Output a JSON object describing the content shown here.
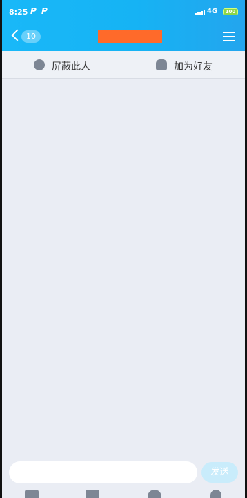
{
  "status_bar": {
    "time": "8:25",
    "app_icon_1": "P",
    "app_icon_2": "P",
    "network": "4G",
    "battery": "100"
  },
  "header": {
    "back_count": "10",
    "menu_icon": "hamburger-menu-icon",
    "title_redaction_color": "#ff6a2a"
  },
  "actions": {
    "block_label": "屏蔽此人",
    "block_icon": "block-face-icon",
    "add_friend_label": "加为好友",
    "add_friend_icon": "add-person-icon"
  },
  "input": {
    "placeholder": "",
    "send_label": "发送"
  },
  "toolbar": {
    "icons": [
      "image-icon",
      "camera-icon",
      "emoji-icon",
      "location-icon"
    ]
  },
  "colors": {
    "header_gradient_start": "#19b8f8",
    "header_gradient_end": "#23a5ee",
    "background": "#eaedf4",
    "send_disabled": "#c9ecfb"
  }
}
